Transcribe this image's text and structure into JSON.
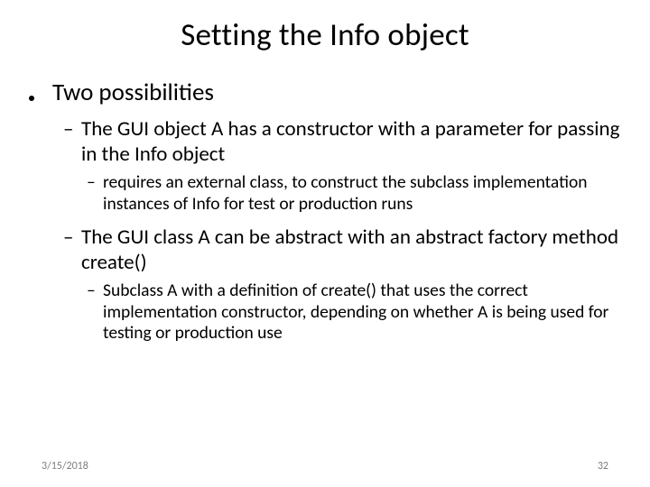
{
  "title": "Setting the Info object",
  "bullets": {
    "l1": "Two possibilities",
    "l2a": "The GUI object A has a constructor with a parameter for passing in the Info object",
    "l3a": "requires an external class, to construct the subclass implementation instances of Info for test or production runs",
    "l2b": "The GUI class A can be abstract with an abstract factory method create()",
    "l3b": "Subclass A with a definition of create() that uses the correct implementation constructor, depending on whether A is being used for testing or production use"
  },
  "footer": {
    "date": "3/15/2018",
    "page": "32"
  }
}
